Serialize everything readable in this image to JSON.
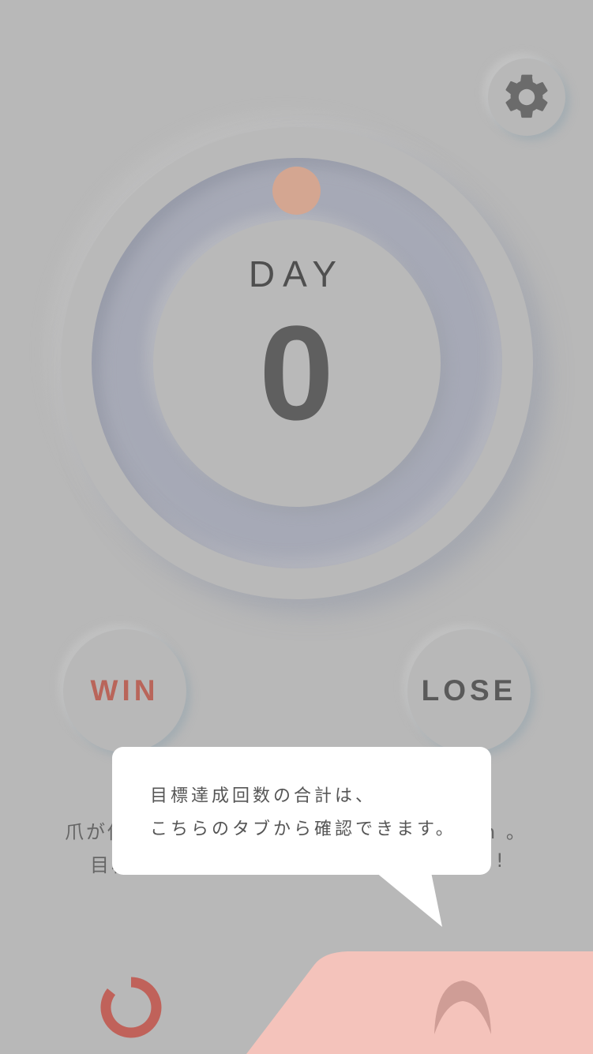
{
  "header": {
    "settings_icon": "gear-icon"
  },
  "counter": {
    "label": "DAY",
    "value": "0",
    "progress_fraction": 0
  },
  "actions": {
    "win_label": "WIN",
    "lose_label": "LOSE"
  },
  "background_message": {
    "line1_left": "爪が伸",
    "line1_right": "n 。",
    "line2_left": "目標",
    "line2_right": "!"
  },
  "tooltip": {
    "line1": "目標達成回数の合計は、",
    "line2": "こちらのタブから確認できます。"
  },
  "tabs": [
    {
      "icon": "progress-ring-icon",
      "active": false
    },
    {
      "icon": "arch-icon",
      "active": true
    }
  ],
  "colors": {
    "background": "#b8b8b8",
    "accent_red": "#c0625a",
    "progress_dot": "#d4a691",
    "active_tab": "#f4c3bb",
    "tooltip_bg": "#ffffff"
  }
}
